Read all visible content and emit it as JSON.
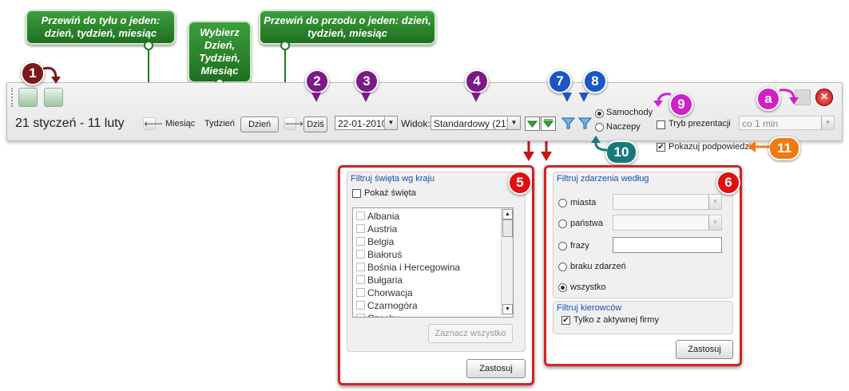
{
  "callouts": {
    "back": "Przewiń do tyłu o jeden: dzień, tydzień, miesiąc",
    "select": "Wybierz Dzień, Tydzień, Miesiąc",
    "forward": "Przewiń do przodu o jeden: dzień, tydzień, miesiąc"
  },
  "badges": {
    "b1": "1",
    "b2": "2",
    "b3": "3",
    "b4": "4",
    "b5": "5",
    "b6": "6",
    "b7": "7",
    "b8": "8",
    "b9": "9",
    "b10": "10",
    "b11": "11",
    "ba": "a"
  },
  "toolbar": {
    "date_range": "21 styczeń - 11 luty",
    "prev_arrow": "🡐",
    "next_arrow": "🡒",
    "month_label": "Miesiąc",
    "week_label": "Tydzień",
    "day_button": "Dzień",
    "today_button": "Dziś",
    "date_value": "22-01-2010",
    "view_label": "Widok:",
    "view_value": "Standardowy (21)",
    "vehicles_label": "Samochody",
    "trailers_label": "Naczepy",
    "presentation_label": "Tryb prezentacji",
    "interval_value": "co 1 min",
    "hints_label": "Pokazuj podpowiedzi"
  },
  "holidays_panel": {
    "title": "Filtruj święta wg kraju",
    "show_label": "Pokaż święta",
    "countries": [
      "Albania",
      "Austria",
      "Belgia",
      "Białoruś",
      "Bośnia i Hercegowina",
      "Bułgaria",
      "Chorwacja",
      "Czarnogóra",
      "Czechy"
    ],
    "select_all": "Zaznacz wszystko",
    "apply": "Zastosuj"
  },
  "events_panel": {
    "title": "Filtruj zdarzenia według",
    "options": [
      "miasta",
      "państwa",
      "frazy",
      "braku zdarzeń",
      "wszystko"
    ],
    "drivers_title": "Filtruj kierowców",
    "active_company_label": "Tylko z aktywnej firmy",
    "apply": "Zastosuj"
  },
  "colors": {
    "callout_green": "#2a8a2a",
    "badge_maroon": "#7a1a1a",
    "badge_purple": "#7b1a86",
    "badge_blue": "#1a56c8",
    "badge_red": "#e01010",
    "badge_magenta": "#d020c8",
    "badge_teal": "#177a78",
    "badge_orange": "#f07a10"
  }
}
